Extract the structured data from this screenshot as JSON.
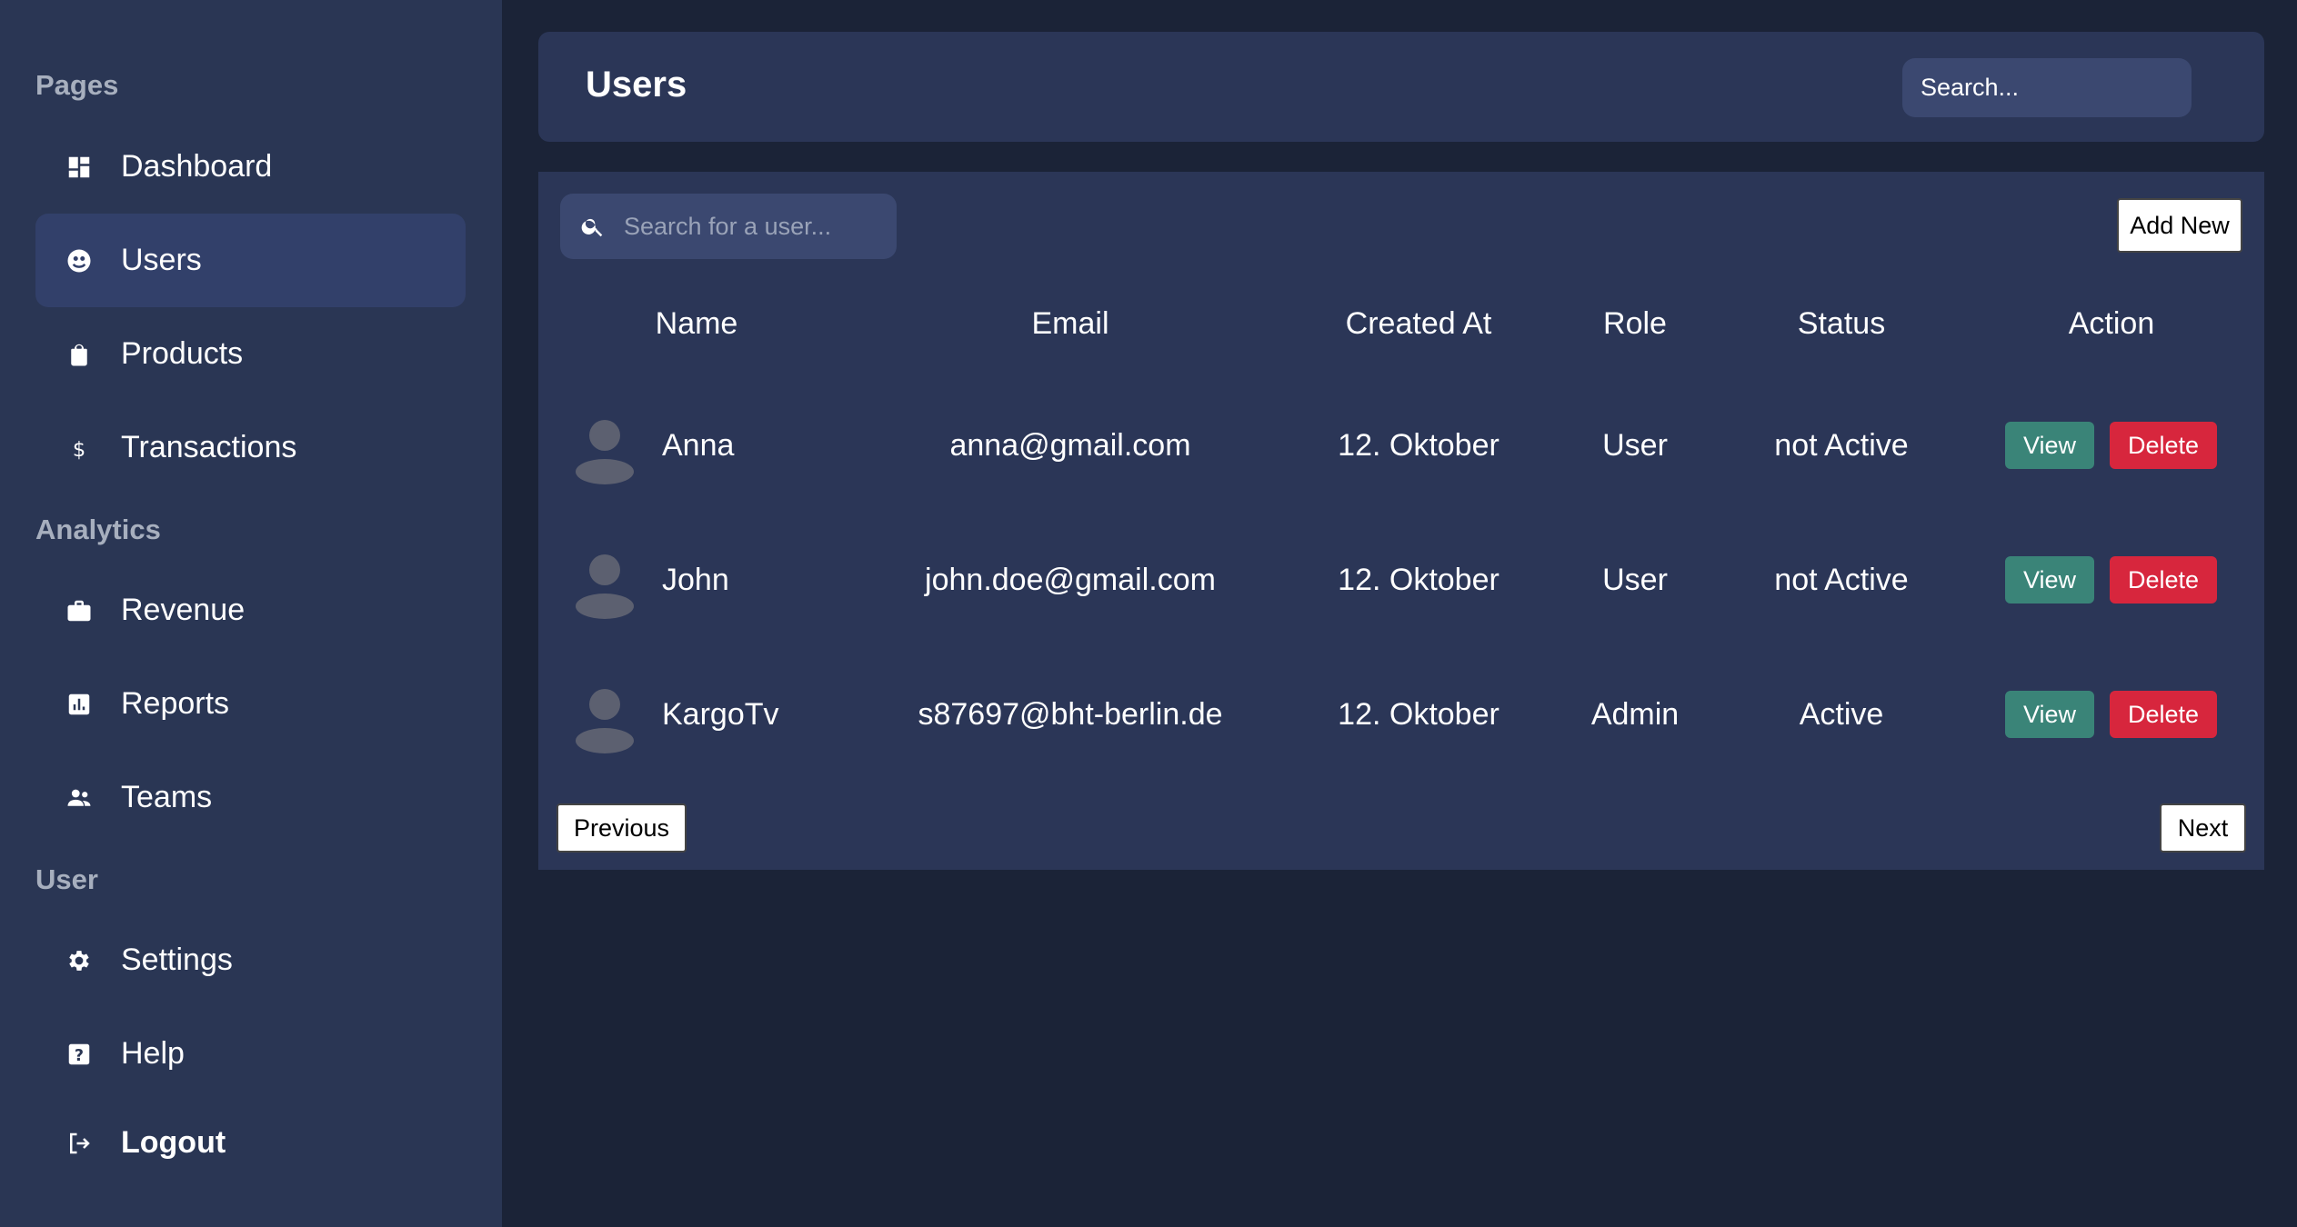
{
  "sidebar": {
    "sections": {
      "pages": "Pages",
      "analytics": "Analytics",
      "user": "User"
    },
    "items": [
      {
        "label": "Dashboard",
        "icon": "dashboard-icon"
      },
      {
        "label": "Users",
        "icon": "users-icon",
        "active": true
      },
      {
        "label": "Products",
        "icon": "bag-icon"
      },
      {
        "label": "Transactions",
        "icon": "dollar-icon"
      },
      {
        "label": "Revenue",
        "icon": "briefcase-icon"
      },
      {
        "label": "Reports",
        "icon": "report-icon"
      },
      {
        "label": "Teams",
        "icon": "team-icon"
      },
      {
        "label": "Settings",
        "icon": "gear-icon"
      },
      {
        "label": "Help",
        "icon": "help-icon"
      },
      {
        "label": "Logout",
        "icon": "logout-icon"
      }
    ]
  },
  "header": {
    "title": "Users",
    "search_placeholder": "Search..."
  },
  "table": {
    "search_placeholder": "Search for a user...",
    "add_new_label": "Add New",
    "columns": [
      "Name",
      "Email",
      "Created At",
      "Role",
      "Status",
      "Action"
    ],
    "rows": [
      {
        "name": "Anna",
        "email": "anna@gmail.com",
        "created": "12. Oktober",
        "role": "User",
        "status": "not Active"
      },
      {
        "name": "John",
        "email": "john.doe@gmail.com",
        "created": "12. Oktober",
        "role": "User",
        "status": "not Active"
      },
      {
        "name": "KargoTv",
        "email": "s87697@bht-berlin.de",
        "created": "12. Oktober",
        "role": "Admin",
        "status": "Active"
      }
    ],
    "view_label": "View",
    "delete_label": "Delete",
    "previous_label": "Previous",
    "next_label": "Next"
  },
  "colors": {
    "background": "#1b2337",
    "sidebar": "#2a3654",
    "panel": "#2b3657",
    "view_button": "#3a8478",
    "delete_button": "#d7263d"
  }
}
